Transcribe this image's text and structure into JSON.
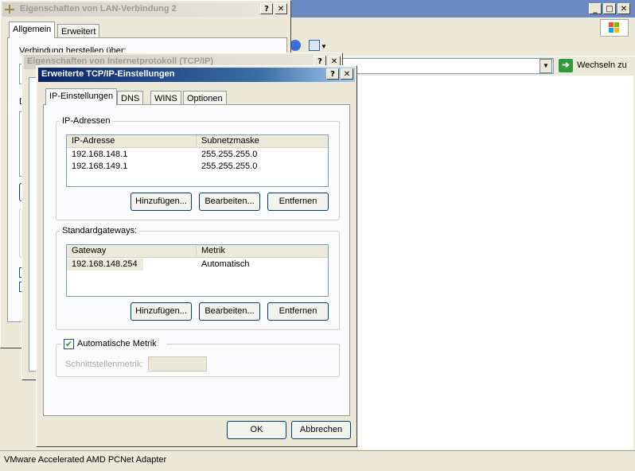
{
  "explorer": {
    "address_go_label": "Wechseln zu",
    "statusbar_text": "VMware Accelerated AMD PCNet Adapter",
    "colors": {
      "windows_flag": [
        "#f25022",
        "#7fba00",
        "#00a4ef",
        "#ffb900"
      ]
    }
  },
  "lan_dialog": {
    "title": "Eigenschaften von LAN-Verbindung 2",
    "help_label": "?",
    "close_label": "✕",
    "tabs": [
      {
        "label": "Allgemein"
      },
      {
        "label": "Erweitert"
      }
    ],
    "partial_labels": {
      "verbinden_label": "Verbindung herstellen über:",
      "d_label": "D"
    }
  },
  "tcpip_dialog": {
    "title": "Eigenschaften von Internetprotokoll (TCP/IP)",
    "help_label": "?",
    "close_label": "✕"
  },
  "advanced_dialog": {
    "title": "Erweiterte TCP/IP-Einstellungen",
    "help_label": "?",
    "close_label": "✕",
    "tabs": [
      {
        "label": "IP-Einstellungen",
        "active": true
      },
      {
        "label": "DNS"
      },
      {
        "label": "WINS"
      },
      {
        "label": "Optionen"
      }
    ],
    "ip_group": {
      "legend": "IP-Adressen",
      "columns": [
        "IP-Adresse",
        "Subnetzmaske"
      ],
      "rows": [
        [
          "192.168.148.1",
          "255.255.255.0"
        ],
        [
          "192.168.149.1",
          "255.255.255.0"
        ]
      ],
      "buttons": {
        "add": "Hinzufügen...",
        "edit": "Bearbeiten...",
        "remove": "Entfernen"
      }
    },
    "gateway_group": {
      "legend": "Standardgateways:",
      "columns": [
        "Gateway",
        "Metrik"
      ],
      "rows": [
        [
          "192.168.148.254",
          "Automatisch"
        ]
      ],
      "buttons": {
        "add": "Hinzufügen...",
        "edit": "Bearbeiten...",
        "remove": "Entfernen"
      }
    },
    "metric": {
      "checkbox_label": "Automatische Metrik",
      "checked": true,
      "check_glyph": "✔",
      "interface_metric_label": "Schnittstellenmetrik:",
      "interface_metric_value": ""
    },
    "ok_label": "OK",
    "cancel_label": "Abbrechen"
  }
}
